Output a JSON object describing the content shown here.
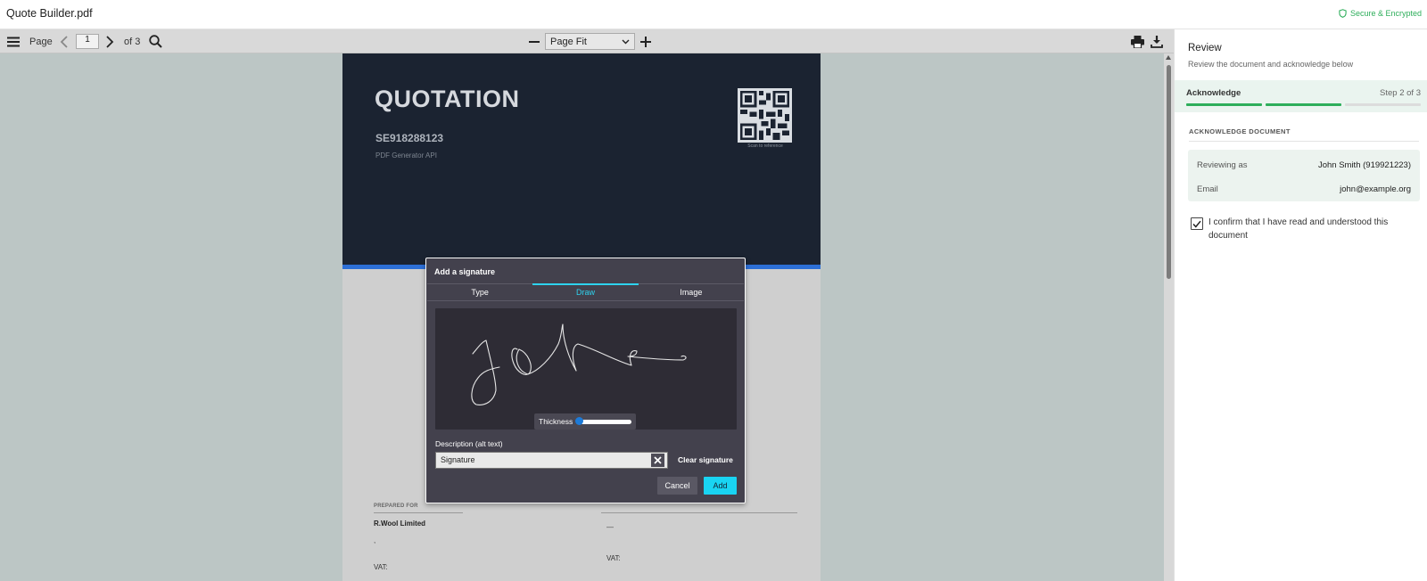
{
  "titlebar": {
    "filename": "Quote Builder.pdf",
    "secure_text": "Secure & Encrypted",
    "secure_icon": "shield-icon"
  },
  "toolbar": {
    "menu_icon": "hamburger-icon",
    "page_label": "Page",
    "current_page": "1",
    "page_total": "of 3",
    "zoom_value": "Page Fit",
    "icons": [
      "chevron-left-icon",
      "chevron-right-icon",
      "search-icon",
      "minus-icon",
      "plus-icon",
      "print-icon",
      "download-icon"
    ]
  },
  "pdf": {
    "title": "QUOTATION",
    "number": "SE918288123",
    "subtitle": "PDF Generator API",
    "qr_caption": "Scan to reference",
    "prepared_for": "PREPARED FOR",
    "client": "R.Wool Limited",
    "comma": ",",
    "vat_left": "VAT:",
    "vat_right": "VAT:",
    "dash": "—"
  },
  "dialog": {
    "title": "Add a signature",
    "tabs": [
      {
        "label": "Type",
        "active": false
      },
      {
        "label": "Draw",
        "active": true
      },
      {
        "label": "Image",
        "active": false
      }
    ],
    "thickness_label": "Thickness",
    "thickness_level": 0.0,
    "description_label": "Description (alt text)",
    "description_value": "Signature",
    "clear_label": "Clear signature",
    "cancel_label": "Cancel",
    "add_label": "Add",
    "accent_color": "#19d4f2"
  },
  "panel": {
    "title": "Review",
    "subtitle": "Review the document and acknowledge below",
    "step_name": "Acknowledge",
    "step_count": "Step 2 of 3",
    "steps_completed": 2,
    "steps_total": 3,
    "section_title": "ACKNOWLEDGE DOCUMENT",
    "reviewing_label": "Reviewing as",
    "reviewing_value": "John Smith (919921223)",
    "email_label": "Email",
    "email_value": "john@example.org",
    "confirm_text": "I confirm that I have read and understood this document",
    "confirm_checked": true,
    "progress_color": "#2eae5b"
  }
}
